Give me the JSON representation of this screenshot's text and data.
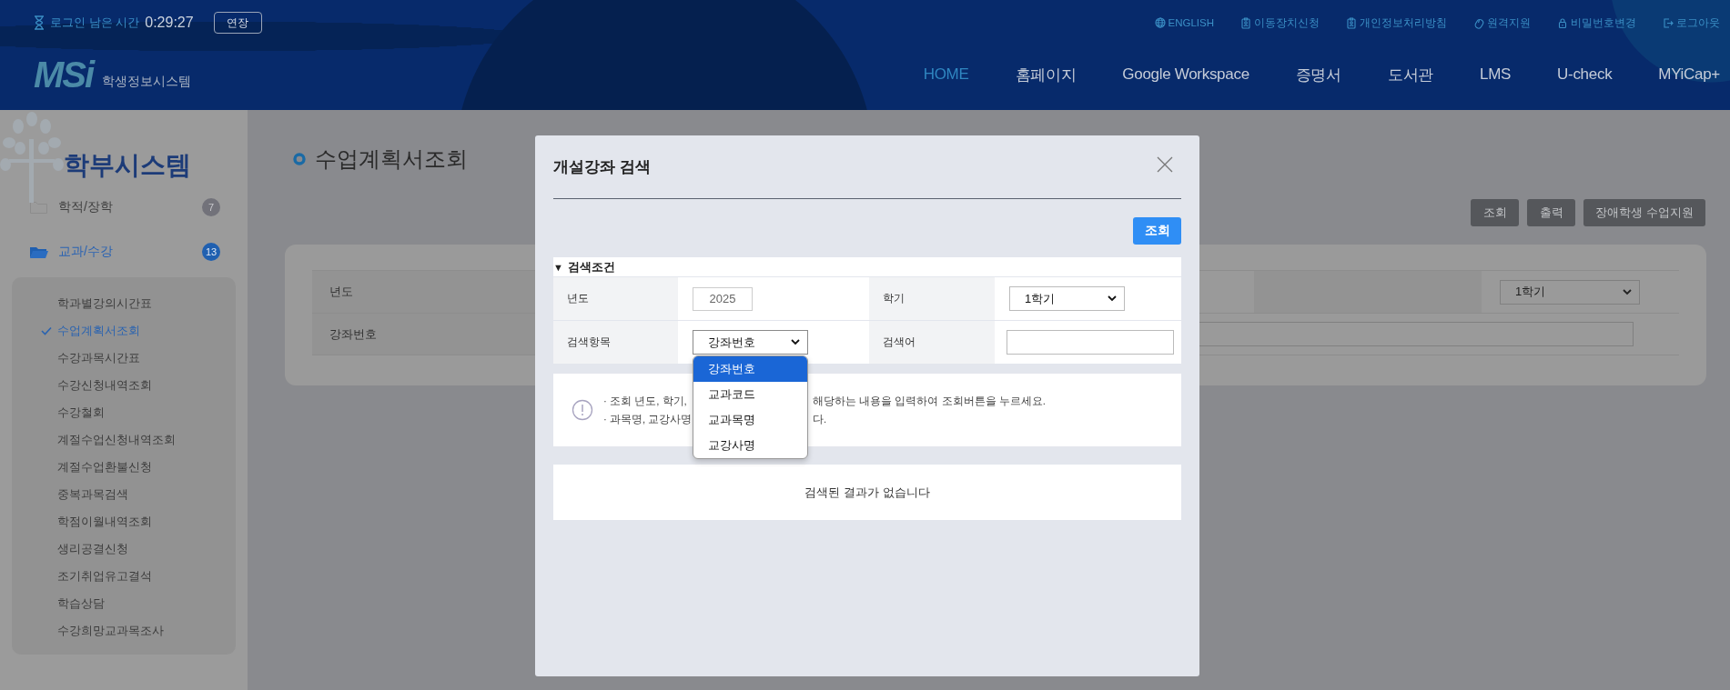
{
  "session": {
    "label": "로그인 남은 시간",
    "time": "0:29:27",
    "extend_button": "연장"
  },
  "utility_links": [
    {
      "kind": "globe",
      "label": "ENGLISH"
    },
    {
      "kind": "badge",
      "label": "이동장치신청"
    },
    {
      "kind": "badge",
      "label": "개인정보처리방침"
    },
    {
      "kind": "mouse",
      "label": "원격지원"
    },
    {
      "kind": "lock",
      "label": "비밀번호변경"
    },
    {
      "kind": "logout",
      "label": "로그아웃"
    }
  ],
  "logo": {
    "mark": "MSi",
    "subtitle": "학생정보시스템"
  },
  "nav": [
    {
      "label": "HOME",
      "selected": true
    },
    {
      "label": "홈페이지",
      "selected": false
    },
    {
      "label": "Google Workspace",
      "selected": false
    },
    {
      "label": "증명서",
      "selected": false
    },
    {
      "label": "도서관",
      "selected": false
    },
    {
      "label": "LMS",
      "selected": false
    },
    {
      "label": "U-check",
      "selected": false
    },
    {
      "label": "MYiCap+",
      "selected": false
    }
  ],
  "sidebar": {
    "title": "학부시스템",
    "menus": [
      {
        "label": "학적/장학",
        "count": "7",
        "expanded": false
      },
      {
        "label": "교과/수강",
        "count": "13",
        "expanded": true,
        "children": [
          {
            "label": "학과별강의시간표",
            "selected": false
          },
          {
            "label": "수업계획서조회",
            "selected": true
          },
          {
            "label": "수강과목시간표",
            "selected": false
          },
          {
            "label": "수강신청내역조회",
            "selected": false
          },
          {
            "label": "수강철회",
            "selected": false
          },
          {
            "label": "계절수업신청내역조회",
            "selected": false
          },
          {
            "label": "계절수업환불신청",
            "selected": false
          },
          {
            "label": "중복과목검색",
            "selected": false
          },
          {
            "label": "학점이월내역조회",
            "selected": false
          },
          {
            "label": "생리공결신청",
            "selected": false
          },
          {
            "label": "조기취업유고결석",
            "selected": false
          },
          {
            "label": "학습상담",
            "selected": false
          },
          {
            "label": "수강희망교과목조사",
            "selected": false
          }
        ]
      }
    ]
  },
  "page": {
    "title": "수업계획서조회",
    "buttons": [
      "조회",
      "출력",
      "장애학생 수업지원"
    ],
    "form": {
      "year_label": "년도",
      "semester_value": "1학기",
      "course_label": "강좌번호"
    }
  },
  "modal": {
    "title": "개설강좌 검색",
    "search_button": "조회",
    "section_toggle": "▼",
    "section_title": "검색조건",
    "year": {
      "label": "년도",
      "value": "2025"
    },
    "semester": {
      "label": "학기",
      "value": "1학기"
    },
    "search_item": {
      "label": "검색항목",
      "value": "강좌번호",
      "expanded": true,
      "options": [
        {
          "label": "강좌번호",
          "selected": true
        },
        {
          "label": "교과코드",
          "selected": false
        },
        {
          "label": "교과목명",
          "selected": false
        },
        {
          "label": "교강사명",
          "selected": false
        }
      ]
    },
    "keyword": {
      "label": "검색어"
    },
    "notes": [
      {
        "before": "· 조회 년도, 학기,",
        "after": "해당하는 내용을 입력하여 조회버튼을 누르세요."
      },
      {
        "before": "· 과목명, 교강사명",
        "after": "다."
      }
    ],
    "results": "검색된 결과가 없습니다"
  }
}
